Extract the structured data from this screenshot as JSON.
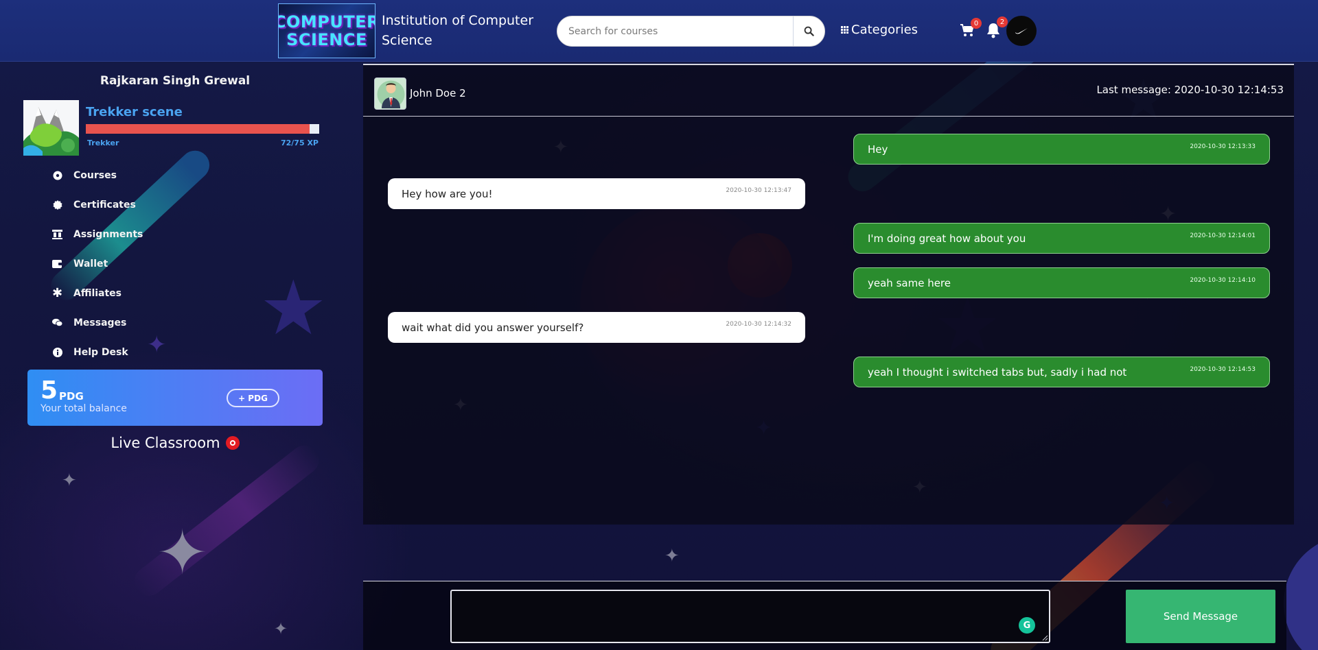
{
  "header": {
    "logo_line1": "COMPUTER",
    "logo_line2": "SCIENCE",
    "site_title": "Institution of Computer Science",
    "search_placeholder": "Search for courses",
    "categories_label": "Categories",
    "cart_count": "0",
    "notification_count": "2"
  },
  "sidebar": {
    "username": "Rajkaran Singh Grewal",
    "rank_name": "Trekker scene",
    "rank_label": "Trekker",
    "xp_label": "72/75 XP",
    "xp_current": 72,
    "xp_max": 75,
    "nav": [
      {
        "label": "Courses",
        "icon": "disc-icon"
      },
      {
        "label": "Certificates",
        "icon": "certificate-icon"
      },
      {
        "label": "Assignments",
        "icon": "assignments-icon"
      },
      {
        "label": "Wallet",
        "icon": "wallet-icon"
      },
      {
        "label": "Affiliates",
        "icon": "asterisk-icon"
      },
      {
        "label": "Messages",
        "icon": "chat-icon"
      },
      {
        "label": "Help Desk",
        "icon": "info-icon"
      }
    ],
    "balance": {
      "amount": "5",
      "unit": "PDG",
      "subtitle": "Your total balance",
      "add_button": "+ PDG"
    },
    "live_classroom": "Live Classroom"
  },
  "chat": {
    "contact_name": "John Doe 2",
    "last_message": "Last message: 2020-10-30 12:14:53",
    "messages": [
      {
        "direction": "out",
        "text": "Hey",
        "time": "2020-10-30 12:13:33"
      },
      {
        "direction": "in",
        "text": "Hey how are you!",
        "time": "2020-10-30 12:13:47"
      },
      {
        "direction": "out",
        "text": "I'm doing great how about you",
        "time": "2020-10-30 12:14:01"
      },
      {
        "direction": "out",
        "text": "yeah same here",
        "time": "2020-10-30 12:14:10"
      },
      {
        "direction": "in",
        "text": "wait what did you answer yourself?",
        "time": "2020-10-30 12:14:32"
      },
      {
        "direction": "out",
        "text": "yeah I thought i switched tabs but, sadly i had not",
        "time": "2020-10-30 12:14:53"
      }
    ],
    "input_value": "",
    "send_label": "Send Message"
  },
  "colors": {
    "header_bg": "#1d2f7c",
    "accent_blue": "#4aa3f0",
    "xp_fill": "#e8534e",
    "outgoing_bubble": "#2a8c2e",
    "send_button": "#36b672",
    "live_dot": "#e31b23"
  }
}
